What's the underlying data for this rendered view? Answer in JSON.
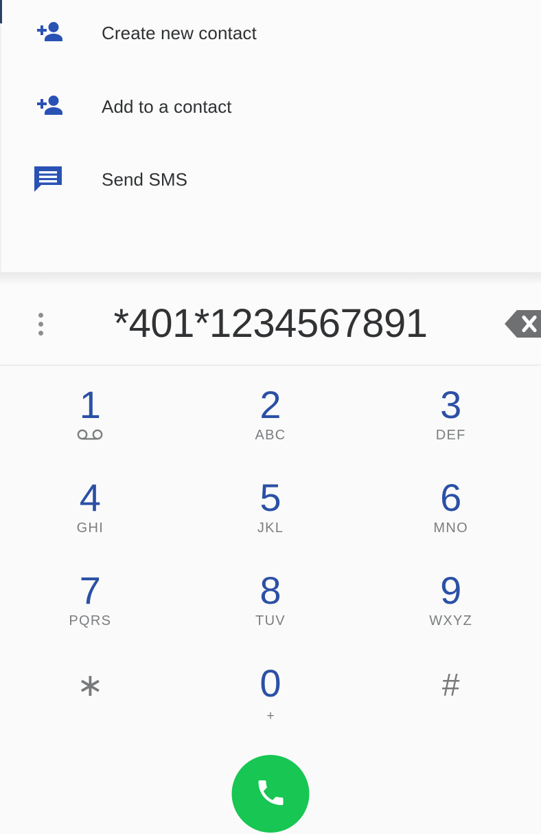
{
  "colors": {
    "icon_blue": "#2a52b5",
    "digit_blue": "#2b50a5",
    "symbol_gray": "#77797b",
    "sub_label_gray": "#7b7d7f",
    "call_green": "#17c653",
    "text_dark": "#2f3133",
    "backspace_gray": "#6e7072",
    "screen_background": "#fafafa",
    "sheet_background": "#fbfbfb"
  },
  "action_sheet": {
    "items": [
      {
        "label": "Create new contact",
        "icon": "person-add-icon"
      },
      {
        "label": "Add to a contact",
        "icon": "person-add-icon"
      },
      {
        "label": "Send SMS",
        "icon": "sms-message-icon"
      }
    ]
  },
  "dialer": {
    "overflow_menu_icon": "more-vert-icon",
    "number": "*401*1234567891",
    "backspace_icon": "backspace-icon"
  },
  "keypad": {
    "rows": [
      [
        {
          "digit": "1",
          "sub": "",
          "sub_kind": "voicemail",
          "style": "digit"
        },
        {
          "digit": "2",
          "sub": "ABC",
          "sub_kind": "letters",
          "style": "digit"
        },
        {
          "digit": "3",
          "sub": "DEF",
          "sub_kind": "letters",
          "style": "digit"
        }
      ],
      [
        {
          "digit": "4",
          "sub": "GHI",
          "sub_kind": "letters",
          "style": "digit"
        },
        {
          "digit": "5",
          "sub": "JKL",
          "sub_kind": "letters",
          "style": "digit"
        },
        {
          "digit": "6",
          "sub": "MNO",
          "sub_kind": "letters",
          "style": "digit"
        }
      ],
      [
        {
          "digit": "7",
          "sub": "PQRS",
          "sub_kind": "letters",
          "style": "digit"
        },
        {
          "digit": "8",
          "sub": "TUV",
          "sub_kind": "letters",
          "style": "digit"
        },
        {
          "digit": "9",
          "sub": "WXYZ",
          "sub_kind": "letters",
          "style": "digit"
        }
      ],
      [
        {
          "digit": "∗",
          "sub": "",
          "sub_kind": "none",
          "style": "symbol"
        },
        {
          "digit": "0",
          "sub": "+",
          "sub_kind": "plus",
          "style": "digit"
        },
        {
          "digit": "#",
          "sub": "",
          "sub_kind": "none",
          "style": "symbol"
        }
      ]
    ]
  },
  "call_button": {
    "icon": "phone-call-icon",
    "label": "Call"
  }
}
